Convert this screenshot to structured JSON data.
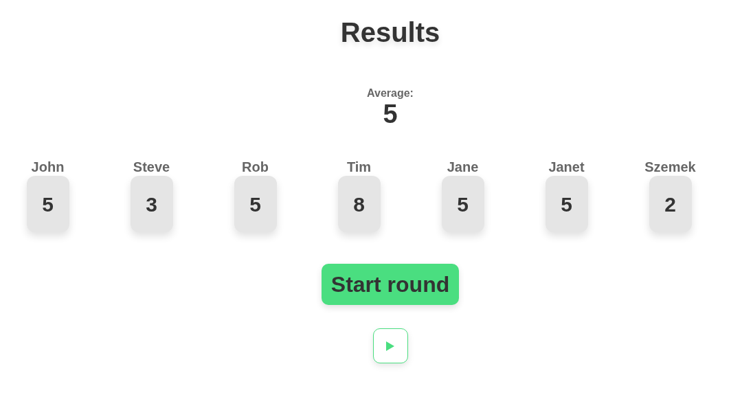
{
  "title": "Results",
  "average": {
    "label": "Average:",
    "value": "5"
  },
  "players": [
    {
      "name": "John",
      "vote": "5"
    },
    {
      "name": "Steve",
      "vote": "3"
    },
    {
      "name": "Rob",
      "vote": "5"
    },
    {
      "name": "Tim",
      "vote": "8"
    },
    {
      "name": "Jane",
      "vote": "5"
    },
    {
      "name": "Janet",
      "vote": "5"
    },
    {
      "name": "Szemek",
      "vote": "2"
    }
  ],
  "buttons": [
    {
      "kind": "text",
      "label": "Start round"
    },
    {
      "kind": "play"
    }
  ]
}
